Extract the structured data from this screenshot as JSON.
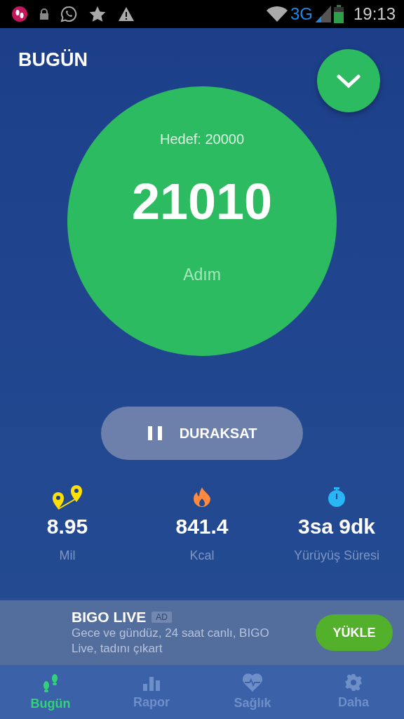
{
  "status_bar": {
    "time": "19:13",
    "network": "3G"
  },
  "header": {
    "title": "BUGÜN"
  },
  "goal": {
    "label": "Hedef: 20000",
    "steps": "21010",
    "unit": "Adım"
  },
  "pause_button": {
    "label": "DURAKSAT"
  },
  "stats": [
    {
      "kind": "distance",
      "value": "8.95",
      "label": "Mil"
    },
    {
      "kind": "calories",
      "value": "841.4",
      "label": "Kcal"
    },
    {
      "kind": "time",
      "value": "3sa 9dk",
      "label": "Yürüyüş Süresi"
    }
  ],
  "ad": {
    "title": "BIGO LIVE",
    "badge": "AD",
    "text": "Gece ve gündüz, 24 saat canlı, BIGO Live, tadını çıkart",
    "button": "YÜKLE"
  },
  "tabs": [
    {
      "kind": "steps",
      "label": "Bugün",
      "selected": true
    },
    {
      "kind": "report",
      "label": "Rapor",
      "selected": false
    },
    {
      "kind": "health",
      "label": "Sağlık",
      "selected": false
    },
    {
      "kind": "more",
      "label": "Daha",
      "selected": false
    }
  ]
}
